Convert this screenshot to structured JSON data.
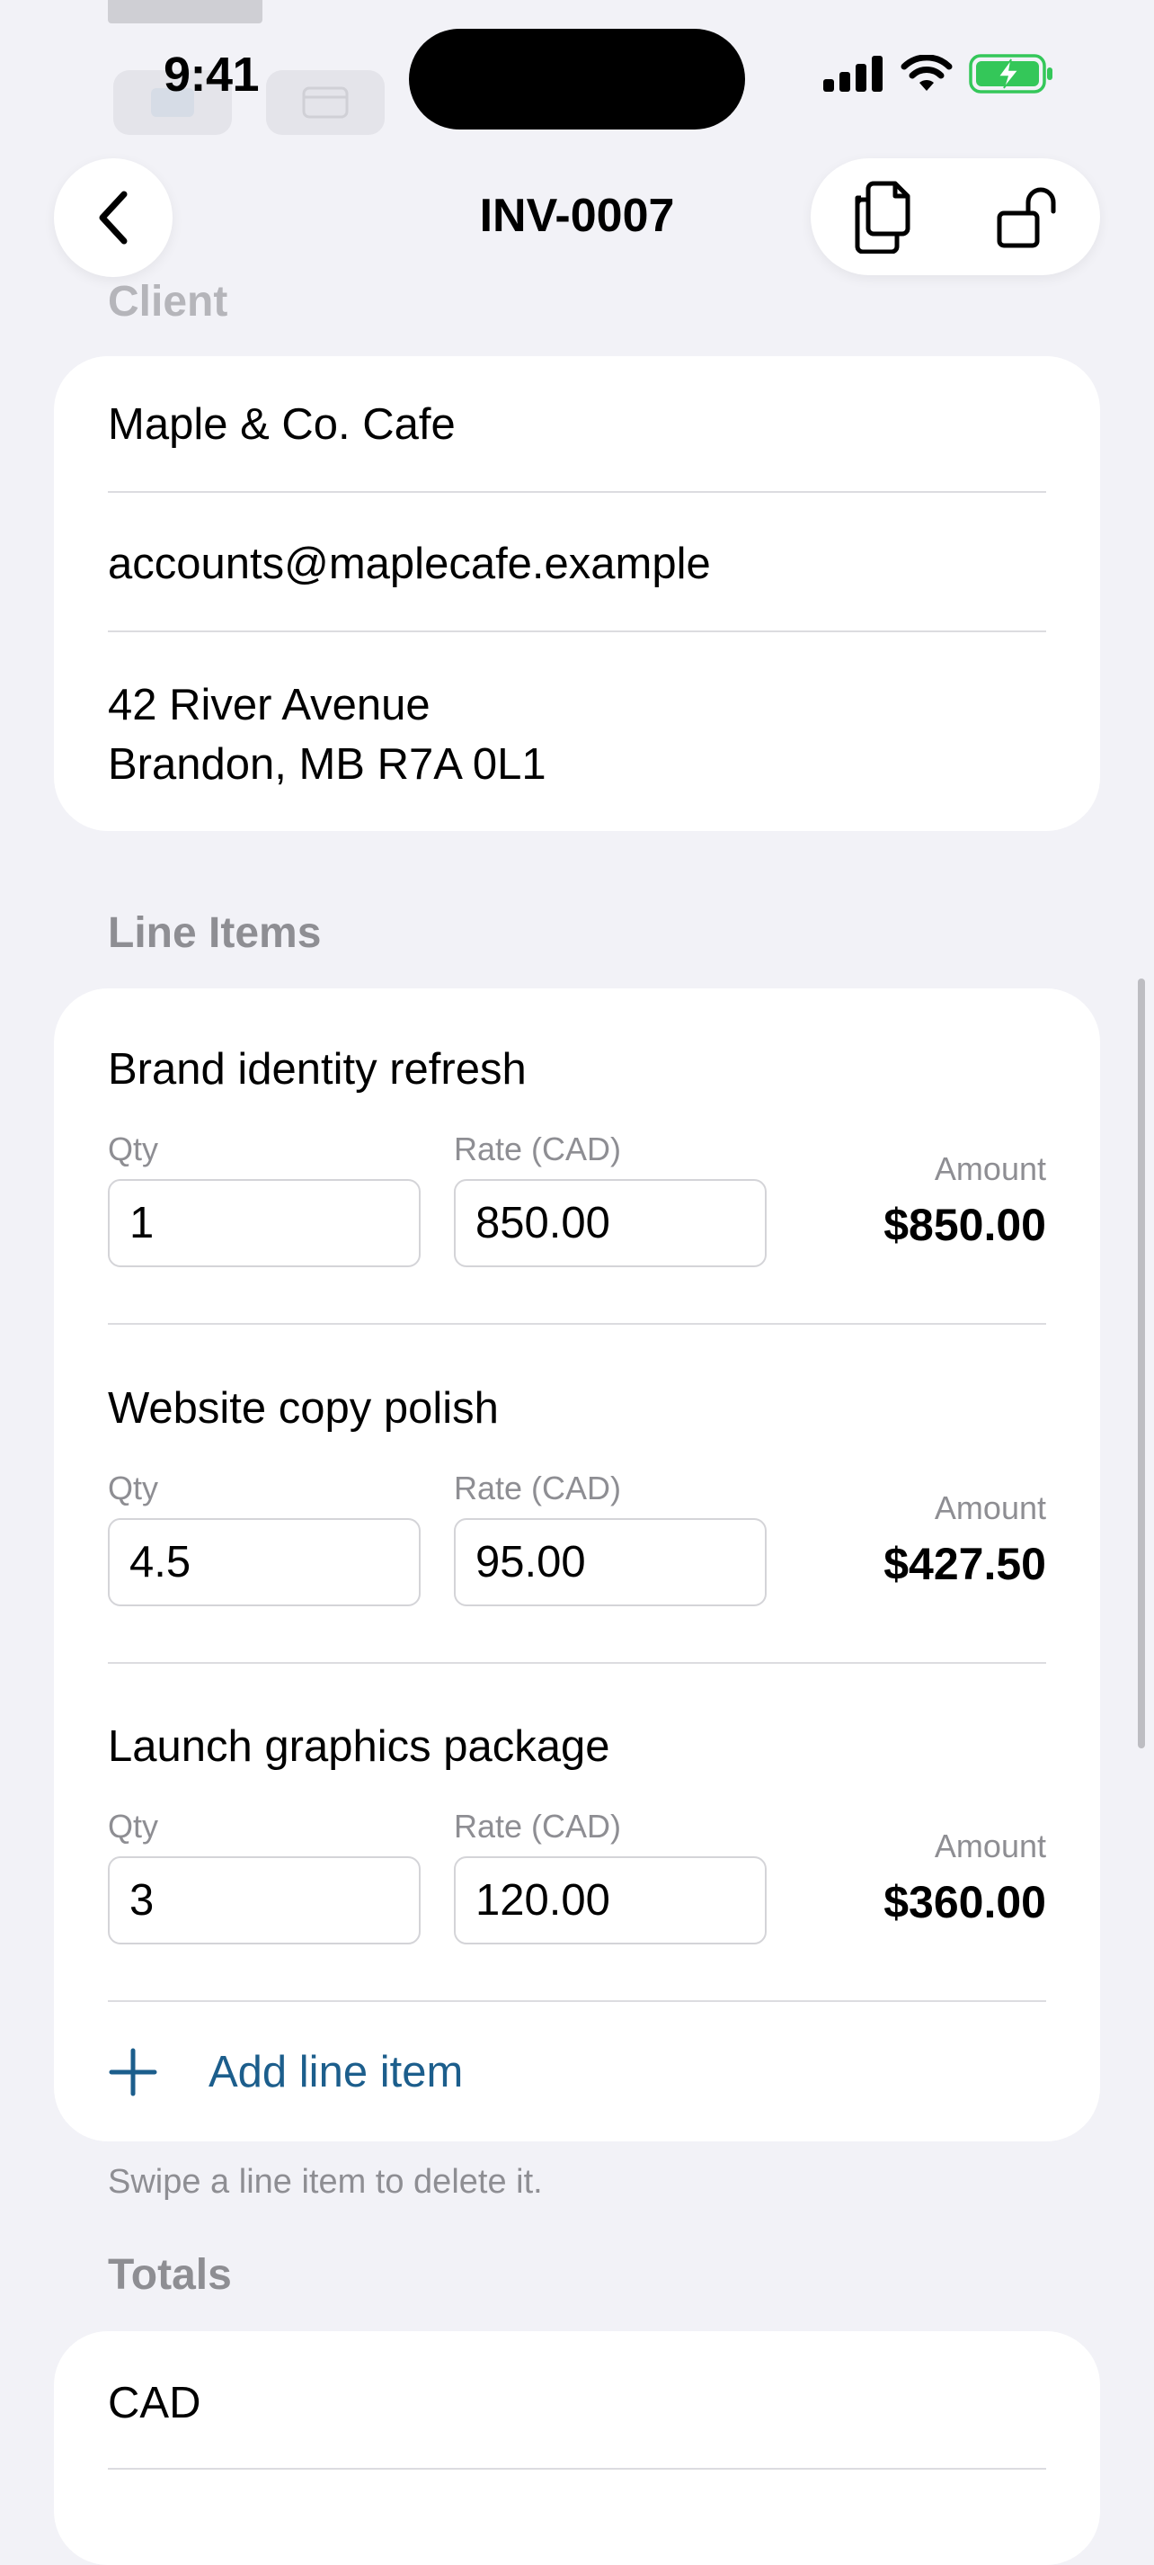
{
  "status_bar": {
    "time": "9:41"
  },
  "header": {
    "title": "INV-0007"
  },
  "client": {
    "section_label": "Client",
    "name": "Maple & Co. Cafe",
    "email": "accounts@maplecafe.example",
    "address_line1": "42 River Avenue",
    "address_line2": "Brandon, MB R7A 0L1"
  },
  "line_items": {
    "section_label": "Line Items",
    "qty_label": "Qty",
    "rate_label": "Rate (CAD)",
    "amount_label": "Amount",
    "items": [
      {
        "name": "Brand identity refresh",
        "qty": "1",
        "rate": "850.00",
        "amount": "$850.00"
      },
      {
        "name": "Website copy polish",
        "qty": "4.5",
        "rate": "95.00",
        "amount": "$427.50"
      },
      {
        "name": "Launch graphics package",
        "qty": "3",
        "rate": "120.00",
        "amount": "$360.00"
      }
    ],
    "add_label": "Add line item",
    "footnote": "Swipe a line item to delete it."
  },
  "totals": {
    "section_label": "Totals",
    "currency": "CAD"
  },
  "colors": {
    "background": "#F2F2F7",
    "card": "#FFFFFF",
    "accent": "#1C5E8C",
    "secondary_text": "#8E8E93",
    "battery": "#34C759"
  },
  "icons": {
    "back": "chevron-left-icon",
    "duplicate": "duplicate-documents-icon",
    "lock": "unlock-padlock-icon",
    "add": "plus-icon"
  }
}
